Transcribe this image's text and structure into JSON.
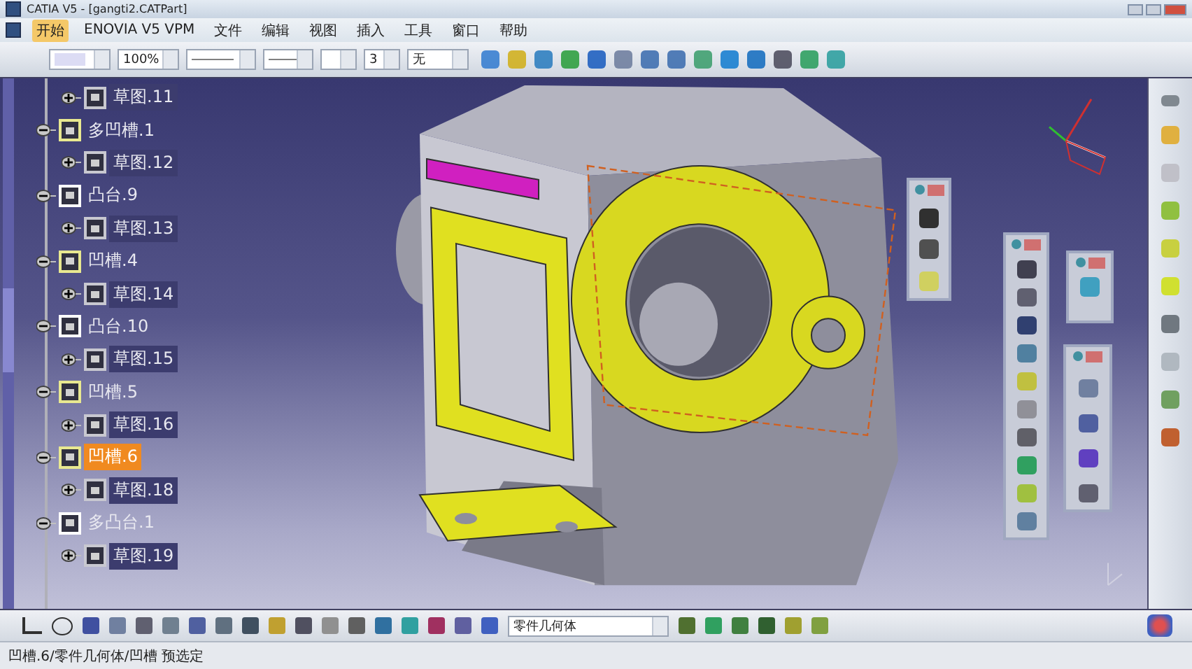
{
  "window": {
    "title": "CATIA V5 - [gangti2.CATPart]"
  },
  "menu": [
    {
      "label": "开始",
      "selected": true
    },
    {
      "label": "ENOVIA V5 VPM",
      "selected": false
    },
    {
      "label": "文件",
      "selected": false
    },
    {
      "label": "编辑",
      "selected": false
    },
    {
      "label": "视图",
      "selected": false
    },
    {
      "label": "插入",
      "selected": false
    },
    {
      "label": "工具",
      "selected": false
    },
    {
      "label": "窗口",
      "selected": false
    },
    {
      "label": "帮助",
      "selected": false
    }
  ],
  "toolbar": {
    "zoom": "100%",
    "line_weight": "3",
    "layer": "无"
  },
  "tree": [
    {
      "label": "草图.11",
      "kind": "sketch",
      "expanded": false,
      "selected": false
    },
    {
      "label": "多凹槽.1",
      "kind": "pocket",
      "expanded": true,
      "selected": false,
      "children": [
        {
          "label": "草图.12",
          "kind": "sketch",
          "expanded": false,
          "selected": false
        }
      ]
    },
    {
      "label": "凸台.9",
      "kind": "pad",
      "expanded": true,
      "selected": false,
      "children": [
        {
          "label": "草图.13",
          "kind": "sketch",
          "expanded": false,
          "selected": false
        }
      ]
    },
    {
      "label": "凹槽.4",
      "kind": "pocket",
      "expanded": true,
      "selected": false,
      "children": [
        {
          "label": "草图.14",
          "kind": "sketch",
          "expanded": false,
          "selected": false
        }
      ]
    },
    {
      "label": "凸台.10",
      "kind": "pad",
      "expanded": true,
      "selected": false,
      "children": [
        {
          "label": "草图.15",
          "kind": "sketch",
          "expanded": false,
          "selected": false
        }
      ]
    },
    {
      "label": "凹槽.5",
      "kind": "pocket",
      "expanded": true,
      "selected": false,
      "children": [
        {
          "label": "草图.16",
          "kind": "sketch",
          "expanded": false,
          "selected": false
        }
      ]
    },
    {
      "label": "凹槽.6",
      "kind": "pocket",
      "expanded": true,
      "selected": true,
      "children": [
        {
          "label": "草图.18",
          "kind": "sketch",
          "expanded": false,
          "selected": false
        }
      ]
    },
    {
      "label": "多凸台.1",
      "kind": "pad",
      "expanded": true,
      "selected": false,
      "children": [
        {
          "label": "草图.19",
          "kind": "sketch",
          "expanded": false,
          "selected": false
        }
      ]
    }
  ],
  "geometry_set": "零件几何体",
  "status_bar": "凹槽.6/零件几何体/凹槽 预选定"
}
